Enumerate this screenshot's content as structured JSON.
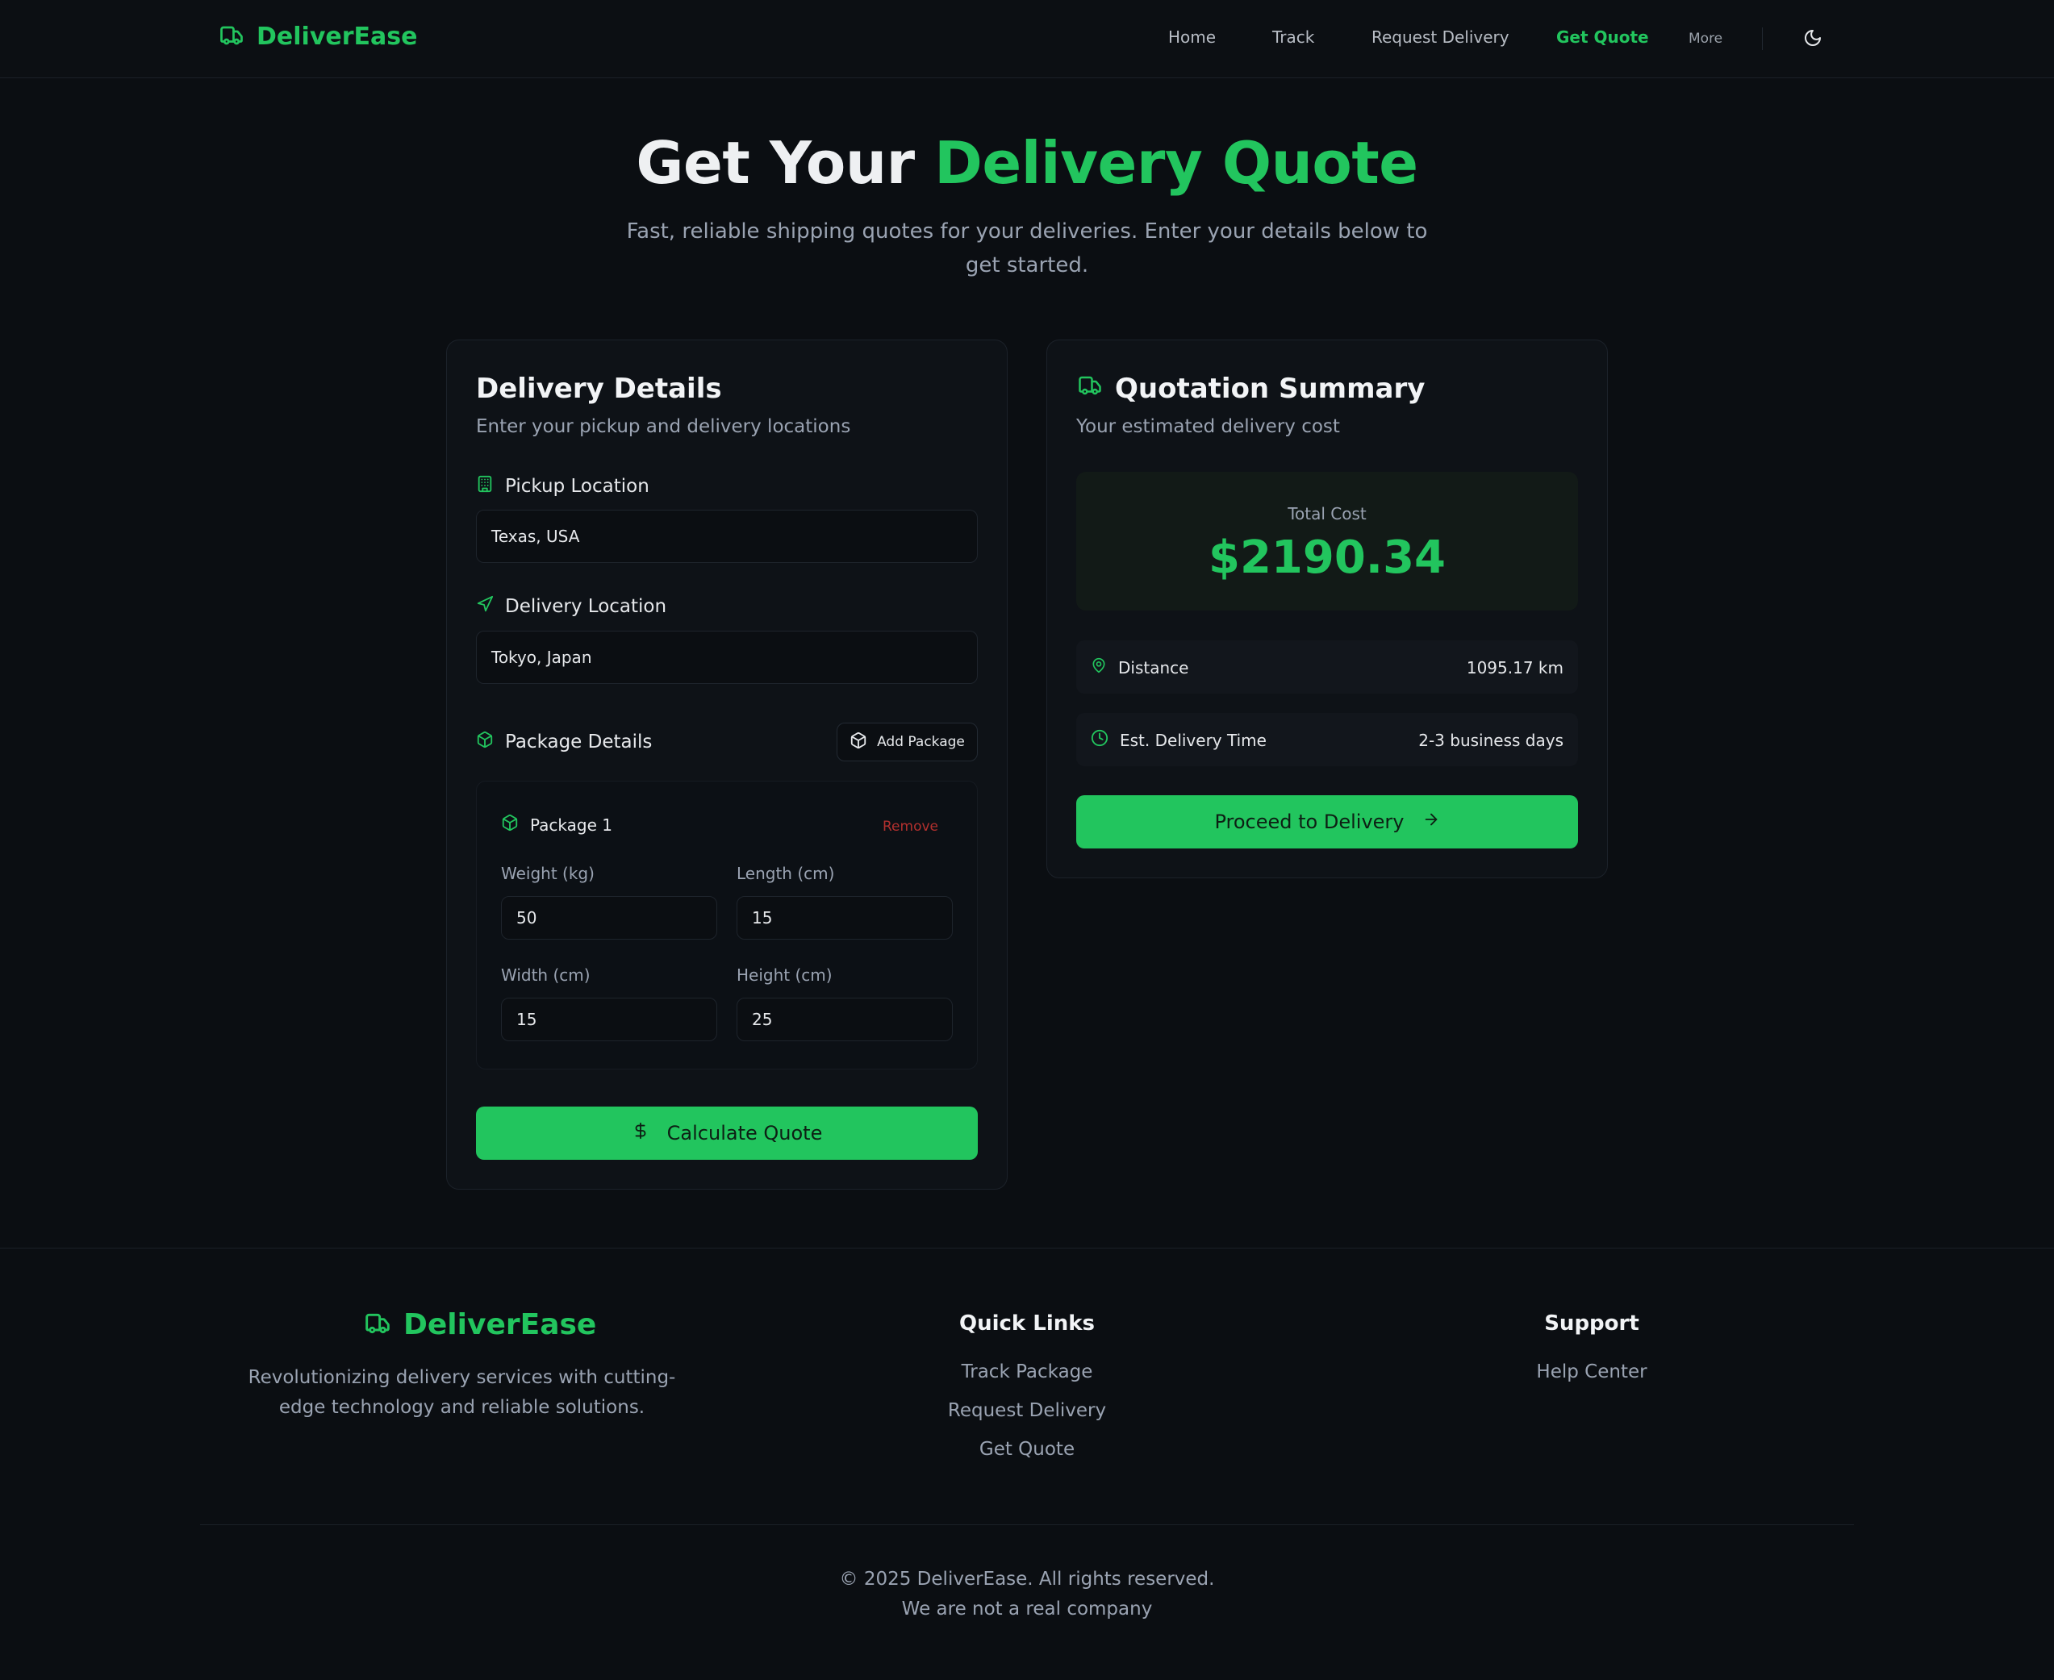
{
  "brand": {
    "name": "DeliverEase"
  },
  "nav": {
    "items": [
      "Home",
      "Track",
      "Request Delivery",
      "Get Quote"
    ],
    "more": "More",
    "active": "Get Quote"
  },
  "hero": {
    "title_white": "Get Your",
    "title_green": "Delivery Quote",
    "subtitle": "Fast, reliable shipping quotes for your deliveries. Enter your details below to get started."
  },
  "delivery_details": {
    "title": "Delivery Details",
    "subtitle": "Enter your pickup and delivery locations",
    "pickup_label": "Pickup Location",
    "pickup_value": "Texas, USA",
    "delivery_label": "Delivery Location",
    "delivery_value": "Tokyo, Japan",
    "package_details_label": "Package Details",
    "add_package_label": "Add Package",
    "package": {
      "name": "Package 1",
      "remove_label": "Remove",
      "weight_label": "Weight (kg)",
      "weight_value": "50",
      "length_label": "Length (cm)",
      "length_value": "15",
      "width_label": "Width (cm)",
      "width_value": "15",
      "height_label": "Height (cm)",
      "height_value": "25"
    },
    "calculate_label": "Calculate Quote"
  },
  "quotation": {
    "title": "Quotation Summary",
    "subtitle": "Your estimated delivery cost",
    "total_label": "Total Cost",
    "total_value": "$2190.34",
    "distance_label": "Distance",
    "distance_value": "1095.17 km",
    "time_label": "Est. Delivery Time",
    "time_value": "2-3 business days",
    "proceed_label": "Proceed to Delivery"
  },
  "footer": {
    "brand": "DeliverEase",
    "description": "Revolutionizing delivery services with cutting-edge technology and reliable solutions.",
    "quick_links_title": "Quick Links",
    "quick_links": [
      "Track Package",
      "Request Delivery",
      "Get Quote"
    ],
    "support_title": "Support",
    "support_links": [
      "Help Center"
    ],
    "copyright": "© 2025 DeliverEase. All rights reserved.",
    "disclaimer": "We are not a real company"
  },
  "colors": {
    "accent": "#22c55e",
    "background": "#0b0e12",
    "danger": "#b2302e"
  },
  "icons": [
    "truck-icon",
    "moon-icon",
    "building-icon",
    "send-icon",
    "package-icon",
    "dollar-icon",
    "map-pin-icon",
    "clock-icon",
    "arrow-right-icon"
  ]
}
